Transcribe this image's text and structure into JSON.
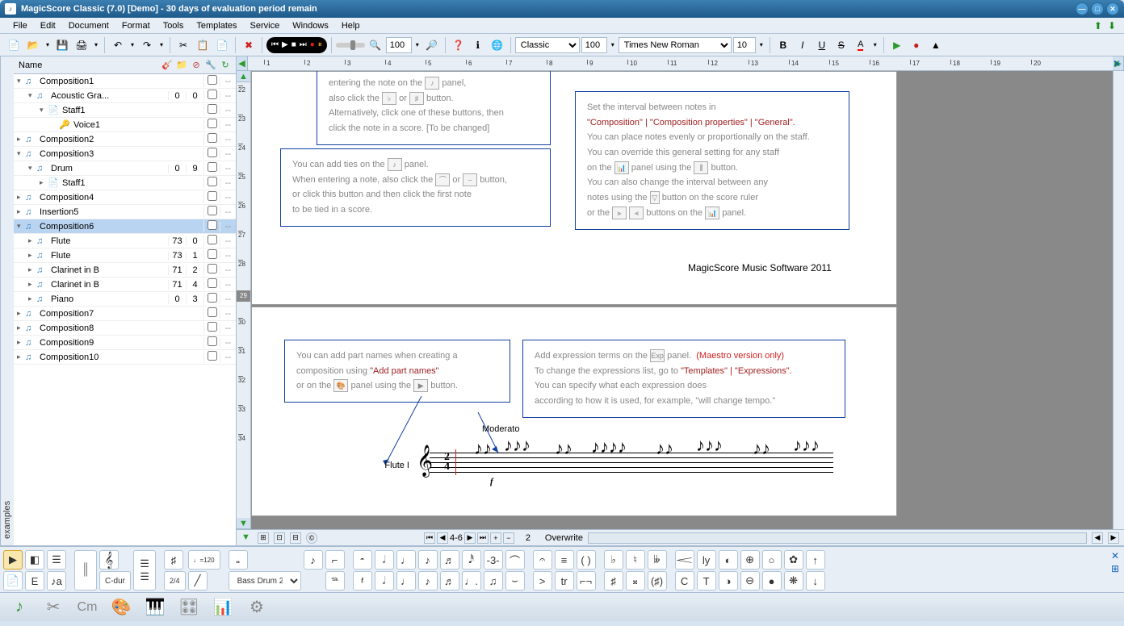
{
  "window": {
    "title": "MagicScore Classic (7.0) [Demo] - 30 days of evaluation period remain"
  },
  "menu": [
    "File",
    "Edit",
    "Document",
    "Format",
    "Tools",
    "Templates",
    "Service",
    "Windows",
    "Help"
  ],
  "toolbar": {
    "zoom": "100",
    "style": "Classic",
    "styleSize": "100",
    "font": "Times New Roman",
    "fontSize": "10"
  },
  "tree": {
    "header": "Name",
    "rows": [
      {
        "depth": 0,
        "toggle": "▾",
        "icon": "♫",
        "cls": "note-icon",
        "name": "Composition1",
        "c1": "",
        "c2": "",
        "cb": false,
        "cd": "--"
      },
      {
        "depth": 1,
        "toggle": "▾",
        "icon": "♫",
        "cls": "note-icon",
        "name": "Acoustic Gra...",
        "c1": "0",
        "c2": "0",
        "cb": false,
        "cd": "--"
      },
      {
        "depth": 2,
        "toggle": "▾",
        "icon": "📄",
        "cls": "folder-icon",
        "name": "Staff1",
        "c1": "",
        "c2": "",
        "cb": false,
        "cd": "--"
      },
      {
        "depth": 3,
        "toggle": "",
        "icon": "🔑",
        "cls": "key-icon",
        "name": "Voice1",
        "c1": "",
        "c2": "",
        "cb": false,
        "cd": "--"
      },
      {
        "depth": 0,
        "toggle": "▸",
        "icon": "♫",
        "cls": "note-icon",
        "name": "Composition2",
        "c1": "",
        "c2": "",
        "cb": false,
        "cd": "--"
      },
      {
        "depth": 0,
        "toggle": "▾",
        "icon": "♫",
        "cls": "note-icon",
        "name": "Composition3",
        "c1": "",
        "c2": "",
        "cb": false,
        "cd": "--"
      },
      {
        "depth": 1,
        "toggle": "▾",
        "icon": "♫",
        "cls": "note-icon",
        "name": "Drum",
        "c1": "0",
        "c2": "9",
        "cb": false,
        "cd": "--"
      },
      {
        "depth": 2,
        "toggle": "▸",
        "icon": "📄",
        "cls": "folder-icon",
        "name": "Staff1",
        "c1": "",
        "c2": "",
        "cb": false,
        "cd": "--"
      },
      {
        "depth": 0,
        "toggle": "▸",
        "icon": "♫",
        "cls": "note-icon",
        "name": "Composition4",
        "c1": "",
        "c2": "",
        "cb": false,
        "cd": "--"
      },
      {
        "depth": 0,
        "toggle": "▸",
        "icon": "♫",
        "cls": "note-icon",
        "name": "Insertion5",
        "c1": "",
        "c2": "",
        "cb": false,
        "cd": "--"
      },
      {
        "depth": 0,
        "toggle": "▾",
        "icon": "♫",
        "cls": "note-icon",
        "name": "Composition6",
        "c1": "",
        "c2": "",
        "cb": false,
        "cd": "--",
        "sel": true
      },
      {
        "depth": 1,
        "toggle": "▸",
        "icon": "♫",
        "cls": "note-icon",
        "name": "Flute",
        "c1": "73",
        "c2": "0",
        "cb": false,
        "cd": "--"
      },
      {
        "depth": 1,
        "toggle": "▸",
        "icon": "♫",
        "cls": "note-icon",
        "name": "Flute",
        "c1": "73",
        "c2": "1",
        "cb": false,
        "cd": "--"
      },
      {
        "depth": 1,
        "toggle": "▸",
        "icon": "♫",
        "cls": "note-icon",
        "name": "Clarinet in B",
        "c1": "71",
        "c2": "2",
        "cb": false,
        "cd": "--"
      },
      {
        "depth": 1,
        "toggle": "▸",
        "icon": "♫",
        "cls": "note-icon",
        "name": "Clarinet in B",
        "c1": "71",
        "c2": "4",
        "cb": false,
        "cd": "--"
      },
      {
        "depth": 1,
        "toggle": "▸",
        "icon": "♫",
        "cls": "note-icon",
        "name": "Piano",
        "c1": "0",
        "c2": "3",
        "cb": false,
        "cd": "--"
      },
      {
        "depth": 0,
        "toggle": "▸",
        "icon": "♫",
        "cls": "note-icon",
        "name": "Composition7",
        "c1": "",
        "c2": "",
        "cb": false,
        "cd": "--"
      },
      {
        "depth": 0,
        "toggle": "▸",
        "icon": "♫",
        "cls": "note-icon",
        "name": "Composition8",
        "c1": "",
        "c2": "",
        "cb": false,
        "cd": "--"
      },
      {
        "depth": 0,
        "toggle": "▸",
        "icon": "♫",
        "cls": "note-icon",
        "name": "Composition9",
        "c1": "",
        "c2": "",
        "cb": false,
        "cd": "--"
      },
      {
        "depth": 0,
        "toggle": "▸",
        "icon": "♫",
        "cls": "note-icon",
        "name": "Composition10",
        "c1": "",
        "c2": "",
        "cb": false,
        "cd": "--"
      }
    ]
  },
  "sidebar": {
    "tab": "examples"
  },
  "doc": {
    "credit": "MagicScore Music Software 2011",
    "hint1a": "entering the note on the",
    "hint1b": "panel,",
    "hint1c": "also click the",
    "hint1d": "or",
    "hint1e": "button.",
    "hint1f": "Alternatively, click one of these buttons, then",
    "hint1g": "click the note in a score. [To be changed]",
    "hint2a": "You can add ties on the",
    "hint2b": "panel.",
    "hint2c": "When entering a note, also click the",
    "hint2d": "or",
    "hint2e": "button,",
    "hint2f": "or click this button and then click the first note",
    "hint2g": "to be tied in a score.",
    "hint3a": "Set the interval between notes in",
    "hint3b": "\"Composition\" | \"Composition properties\" | \"General\".",
    "hint3c": "You can place notes evenly or proportionally on the staff.",
    "hint3d": "You can override this general setting for any staff",
    "hint3e": "on the",
    "hint3f": "panel using the",
    "hint3g": "button.",
    "hint3h": "You can also change the interval between any",
    "hint3i": "notes using the",
    "hint3j": "button on the score ruler",
    "hint3k": "or the",
    "hint3l": "buttons on the",
    "hint3m": "panel.",
    "hint4a": "You can add part names when creating a",
    "hint4b": "composition using",
    "hint4c": "\"Add part names\"",
    "hint4d": "or on the",
    "hint4e": "panel using the",
    "hint4f": "button.",
    "hint5a": "Add expression terms on the",
    "hint5b": "panel.",
    "hint5c": "(Maestro version only)",
    "hint5d": "To change the expressions list, go to",
    "hint5e": "\"Templates\" | \"Expressions\".",
    "hint5f": "You can specify what each expression does",
    "hint5g": "according to how it is used, for example, \"will change tempo.\"",
    "tempo": "Moderato",
    "partName": "Flute I",
    "dynamic": "f",
    "timeSig1": "2",
    "timeSig2": "4"
  },
  "ruler": {
    "hilite": "29"
  },
  "status": {
    "pages": "4-6",
    "pageNum": "2",
    "mode": "Overwrite"
  },
  "palette": {
    "keysig": "C-dur",
    "timesig": "2/4",
    "tempo": "♩=120",
    "drum": "Bass Drum 2"
  }
}
